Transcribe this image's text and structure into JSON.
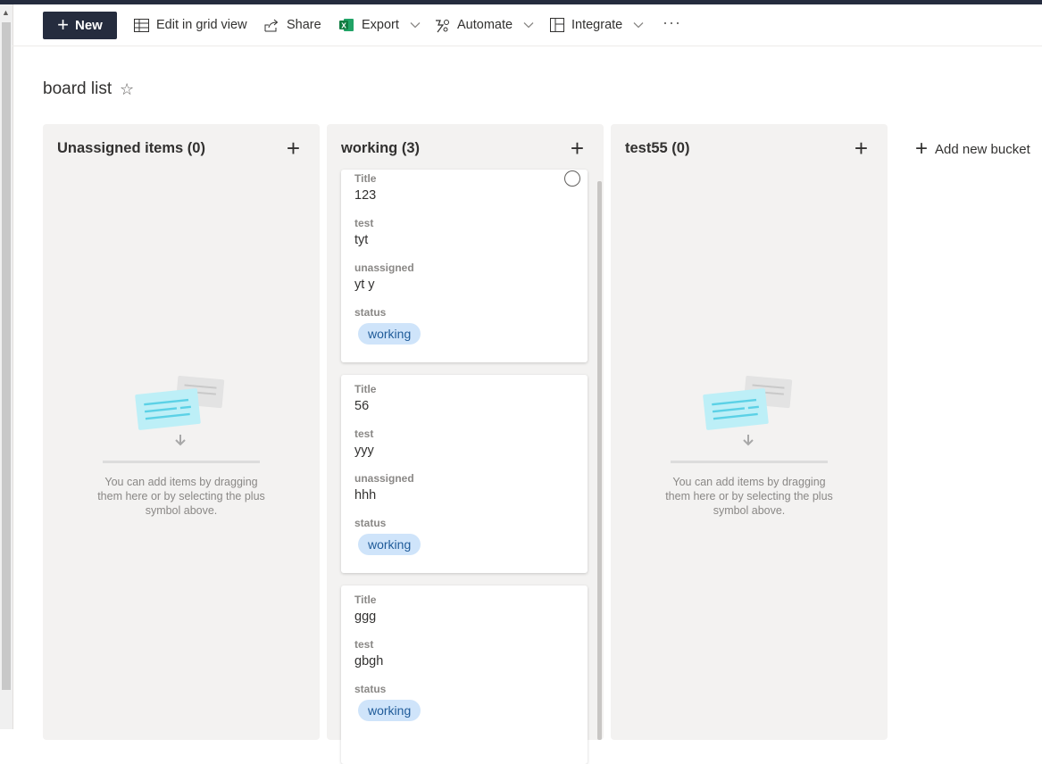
{
  "commandbar": {
    "new_label": "New",
    "grid_label": "Edit in grid view",
    "share_label": "Share",
    "export_label": "Export",
    "automate_label": "Automate",
    "integrate_label": "Integrate",
    "more_label": "···"
  },
  "page": {
    "title": "board list",
    "star": "☆"
  },
  "buckets": [
    {
      "title": "Unassigned items (0)",
      "empty_text": "You can add items by dragging them here or by selecting the plus symbol above."
    },
    {
      "title": "working (3)",
      "cards": [
        {
          "title_label": "Title",
          "title_value": "123",
          "test_label": "test",
          "test_value": "tyt",
          "unassigned_label": "unassigned",
          "unassigned_value": "yt y",
          "status_label": "status",
          "status_value": "working"
        },
        {
          "title_label": "Title",
          "title_value": "56",
          "test_label": "test",
          "test_value": "yyy",
          "unassigned_label": "unassigned",
          "unassigned_value": "hhh",
          "status_label": "status",
          "status_value": "working"
        },
        {
          "title_label": "Title",
          "title_value": "ggg",
          "test_label": "test",
          "test_value": "gbgh",
          "status_label": "status",
          "status_value": "working"
        }
      ]
    },
    {
      "title": "test55 (0)",
      "empty_text": "You can add items by dragging them here or by selecting the plus symbol above."
    }
  ],
  "add_bucket_label": "Add new bucket",
  "colors": {
    "accent": "#252c3e",
    "status_pill": "#cfe4fa",
    "status_text": "#1f5b99",
    "bucket_bg": "#f3f2f1"
  }
}
